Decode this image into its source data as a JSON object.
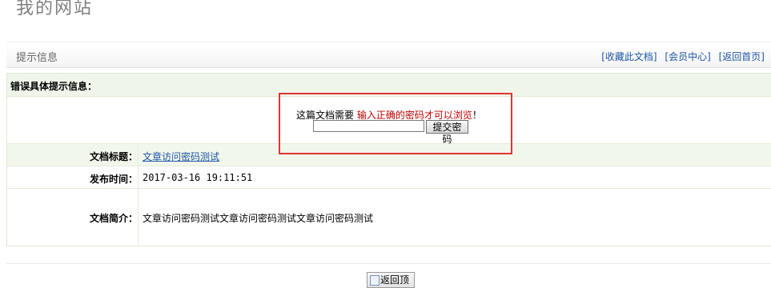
{
  "header": {
    "site_title": "我的网站"
  },
  "breadcrumb": {
    "title": "提示信息",
    "links": [
      "[收藏此文档]",
      "[会员中心]",
      "[返回首页]"
    ]
  },
  "panel": {
    "heading": "错误具体提示信息：",
    "password": {
      "text_before": "这篇文档需要 ",
      "text_red": "输入正确的密码才可以浏览",
      "text_after": "！",
      "input_value": "",
      "submit_label": "提交密码"
    },
    "rows": [
      {
        "label": "文档标题：",
        "value": "文章访问密码测试"
      },
      {
        "label": "发布时间：",
        "value": "2017-03-16 19:11:51"
      },
      {
        "label": "文档简介：",
        "value": "文章访问密码测试文章访问密码测试文章访问密码测试"
      }
    ]
  },
  "footer": {
    "back_label": "返回顶"
  },
  "colors": {
    "highlight_box": "#e03434",
    "warning_text": "#c00000",
    "link": "#1f57a5"
  }
}
